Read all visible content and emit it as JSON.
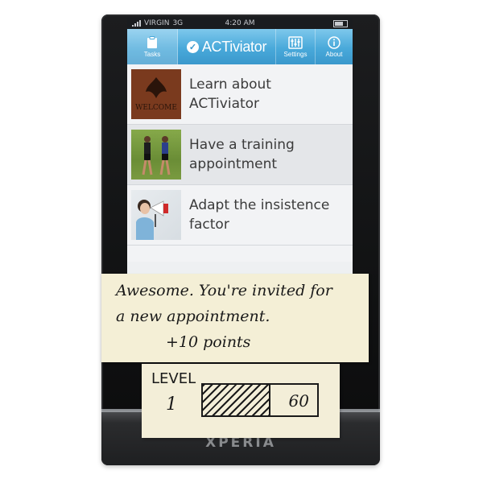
{
  "statusbar": {
    "carrier": "VIRGIN",
    "network": "3G",
    "time": "4:20 AM"
  },
  "navbar": {
    "tasks_label": "Tasks",
    "app_title": "ACTiviator",
    "settings_label": "Settings",
    "about_label": "About"
  },
  "list": {
    "items": [
      {
        "label": "Learn about ACTiviator",
        "thumb_text": "WELCOME"
      },
      {
        "label": "Have a training appointment"
      },
      {
        "label": "Adapt the insistence factor"
      }
    ]
  },
  "note": {
    "line1": "Awesome. You're invited for",
    "line2": "a new appointment.",
    "line3": "+10 points"
  },
  "level": {
    "label": "LEVEL",
    "value": "1",
    "max": "60",
    "progress_fraction": 0.58
  },
  "device": {
    "brand": "XPERIA"
  },
  "colors": {
    "navbar": "#49a9da",
    "screen_bg": "#eef0f2",
    "note_paper": "#f4efd6"
  }
}
